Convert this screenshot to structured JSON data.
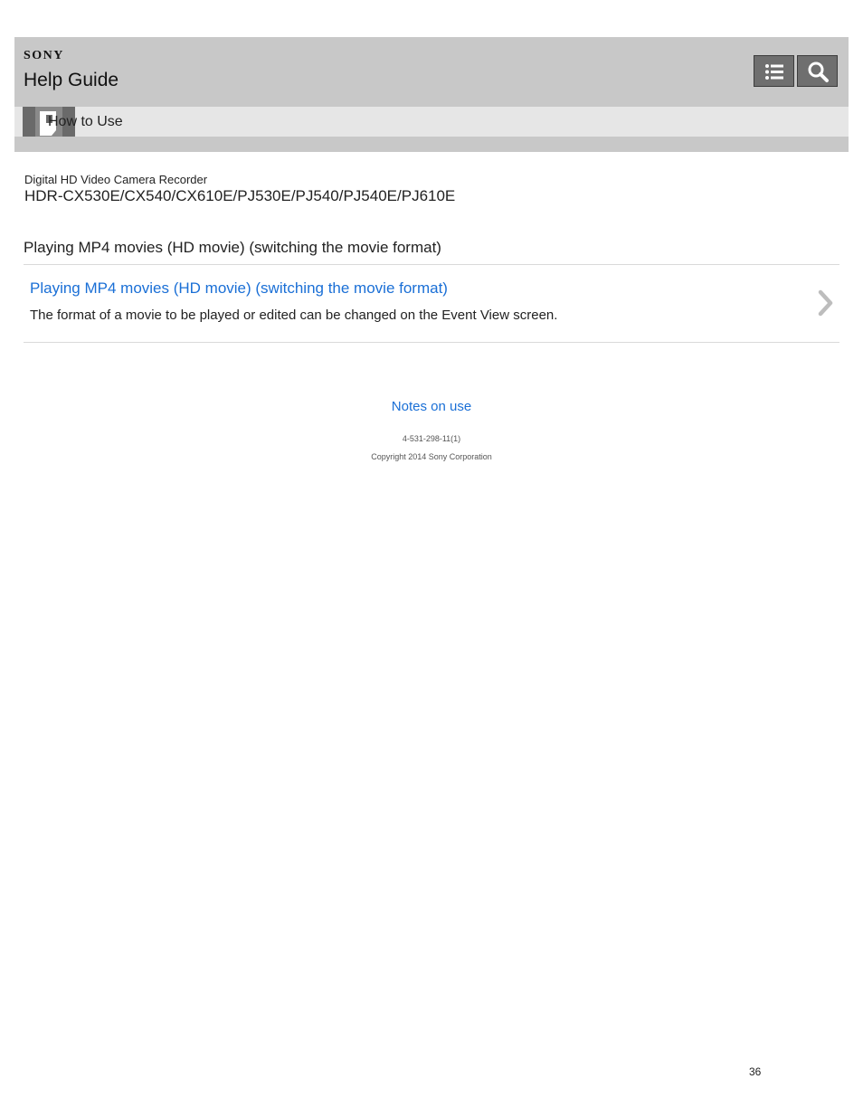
{
  "header": {
    "brand": "SONY",
    "title": "Help Guide",
    "menu_icon": "list-icon",
    "search_icon": "search-icon",
    "background_color": "#c8c8c8"
  },
  "subbar": {
    "icon": "book-icon",
    "label": "How to Use",
    "background_color": "#e6e6e6"
  },
  "product": {
    "category": "Digital HD Video Camera Recorder",
    "model": "HDR-CX530E/CX540/CX610E/PJ530E/PJ540/PJ540E/PJ610E"
  },
  "section": {
    "heading": "Playing MP4 movies (HD movie) (switching the movie format)"
  },
  "entries": [
    {
      "link": "Playing MP4 movies (HD movie) (switching the movie format)",
      "description": "The format of a movie to be played or edited can be changed on the Event View screen.",
      "icon": "chevron-right-icon"
    }
  ],
  "footer": {
    "notes_link": "Notes on use",
    "doc_code": "4-531-298-11(1)",
    "copyright": "Copyright 2014 Sony Corporation",
    "page_number": "36"
  },
  "colors": {
    "link": "#1a6fd6",
    "button": "#6f6f6f"
  }
}
